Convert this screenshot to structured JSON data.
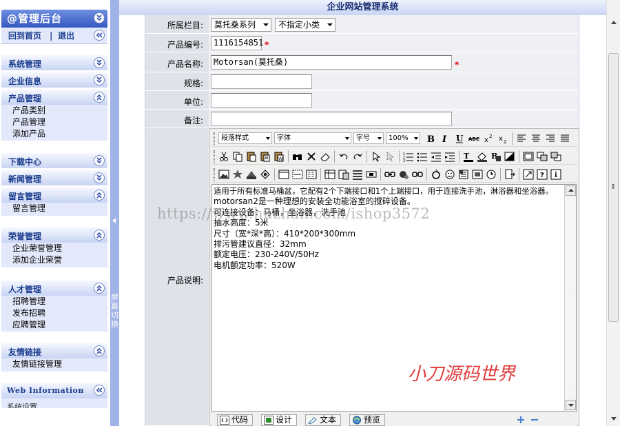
{
  "sidebar": {
    "title": "@管理后台",
    "nav": {
      "home": "回到首页",
      "sep": "|",
      "logout": "退出"
    },
    "groups": [
      {
        "label": "系统管理",
        "expanded": false,
        "items": []
      },
      {
        "label": "企业信息",
        "expanded": false,
        "items": []
      },
      {
        "label": "产品管理",
        "expanded": true,
        "items": [
          "产品类别",
          "产品管理",
          "添加产品"
        ]
      },
      {
        "label": "下载中心",
        "expanded": false,
        "items": []
      },
      {
        "label": "新闻管理",
        "expanded": false,
        "items": []
      },
      {
        "label": "留言管理",
        "expanded": true,
        "items": [
          "留言管理"
        ]
      },
      {
        "label": "荣誉管理",
        "expanded": true,
        "items": [
          "企业荣誉管理",
          "添加企业荣誉"
        ]
      },
      {
        "label": "人才管理",
        "expanded": true,
        "items": [
          "招聘管理",
          "发布招聘",
          "应聘管理"
        ]
      },
      {
        "label": "友情链接",
        "expanded": true,
        "items": [
          "友情链接管理"
        ]
      }
    ],
    "web_info": {
      "label": "Web Information",
      "sub": "系统设置"
    }
  },
  "splitter": {
    "label": "屏幕切换"
  },
  "main": {
    "title": "企业网站管理系统",
    "form": {
      "category_label": "所属栏目:",
      "category_value": "莫托桑系列",
      "subcategory_value": "不指定小类",
      "code_label": "产品编号:",
      "code_value": "1116154851",
      "name_label": "产品名称:",
      "name_value": "Motorsan(莫托桑)",
      "spec_label": "规格:",
      "spec_value": "",
      "unit_label": "单位:",
      "unit_value": "",
      "remark_label": "备注:",
      "remark_value": "",
      "desc_label": "产品说明:",
      "required_mark": "*"
    },
    "editor": {
      "paragraph_select": "段落样式",
      "font_select": "字体",
      "size_select": "字号",
      "zoom_select": "100%",
      "content_lines": [
        "适用于所有标准马桶盆，它配有2个下端接口和1个上端接口，用于连接洗手池，淋浴器和坐浴器。",
        "motorsan2是一种理想的安装全功能浴室的搅碎设备。",
        "可连接设备：马桶，坐浴器，洗手池",
        "抽水高度：5米",
        "尺寸（宽*深*高）：410*200*300mm",
        "排污管建议直径：32mm",
        "额定电压：230-240V/50Hz",
        "电机额定功率：520W"
      ],
      "tabs": [
        "代码",
        "设计",
        "文本",
        "预览"
      ],
      "active_tab": "设计"
    },
    "watermark": "https://www.huzhan.com/ishop3572",
    "signature": "小刀源码世界"
  }
}
